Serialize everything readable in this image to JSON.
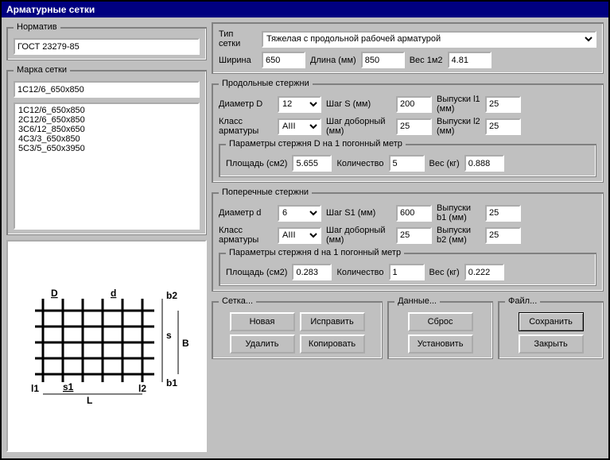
{
  "title": "Арматурные сетки",
  "normative": {
    "legend": "Норматив",
    "value": "ГОСТ 23279-85"
  },
  "mark": {
    "legend": "Марка сетки",
    "current": "1C12/6_650x850",
    "items": [
      "1C12/6_650x850",
      "2C12/6_650x850",
      "3C6/12_850x650",
      "4C3/3_650x850",
      "5C3/5_650x3950"
    ]
  },
  "meshType": {
    "typeLabel": "Тип сетки",
    "typeValue": "Тяжелая с продольной рабочей арматурой",
    "widthLabel": "Ширина",
    "widthValue": "650",
    "lengthLabel": "Длина (мм)",
    "lengthValue": "850",
    "wtLabel": "Вес 1м2",
    "wtValue": "4.81"
  },
  "longBars": {
    "legend": "Продольные стержни",
    "diamLabel": "Диаметр D",
    "diamValue": "12",
    "stepLabel": "Шаг S (мм)",
    "stepValue": "200",
    "rel1Label": "Выпуски l1 (мм)",
    "rel1Value": "25",
    "classLabel": "Класс арматуры",
    "classValue": "AIII",
    "step2Label": "Шаг доборный (мм)",
    "step2Value": "25",
    "rel2Label": "Выпуски l2 (мм)",
    "rel2Value": "25",
    "paramLegend": "Параметры стержня D на 1 погонный метр",
    "areaLabel": "Площадь (см2)",
    "areaValue": "5.655",
    "countLabel": "Количество",
    "countValue": "5",
    "wtLabel": "Вес (кг)",
    "wtValue": "0.888"
  },
  "crossBars": {
    "legend": "Поперечные стержни",
    "diamLabel": "Диаметр d",
    "diamValue": "6",
    "stepLabel": "Шаг S1 (мм)",
    "stepValue": "600",
    "rel1Label": "Выпуски b1 (мм)",
    "rel1Value": "25",
    "classLabel": "Класс арматуры",
    "classValue": "AIII",
    "step2Label": "Шаг доборный (мм)",
    "step2Value": "25",
    "rel2Label": "Выпуски b2 (мм)",
    "rel2Value": "25",
    "paramLegend": "Параметры стержня d на 1 погонный метр",
    "areaLabel": "Площадь (см2)",
    "areaValue": "0.283",
    "countLabel": "Количество",
    "countValue": "1",
    "wtLabel": "Вес (кг)",
    "wtValue": "0.222"
  },
  "meshBtns": {
    "legend": "Сетка...",
    "new": "Новая",
    "fix": "Исправить",
    "del": "Удалить",
    "copy": "Копировать"
  },
  "dataBtns": {
    "legend": "Данные...",
    "reset": "Сброс",
    "set": "Установить"
  },
  "fileBtns": {
    "legend": "Файл...",
    "save": "Сохранить",
    "close": "Закрыть"
  },
  "diagram": {
    "D": "D",
    "d": "d",
    "b1": "b1",
    "b2": "b2",
    "B": "B",
    "l1": "l1",
    "l2": "l2",
    "s": "s",
    "s1": "s1",
    "L": "L"
  }
}
